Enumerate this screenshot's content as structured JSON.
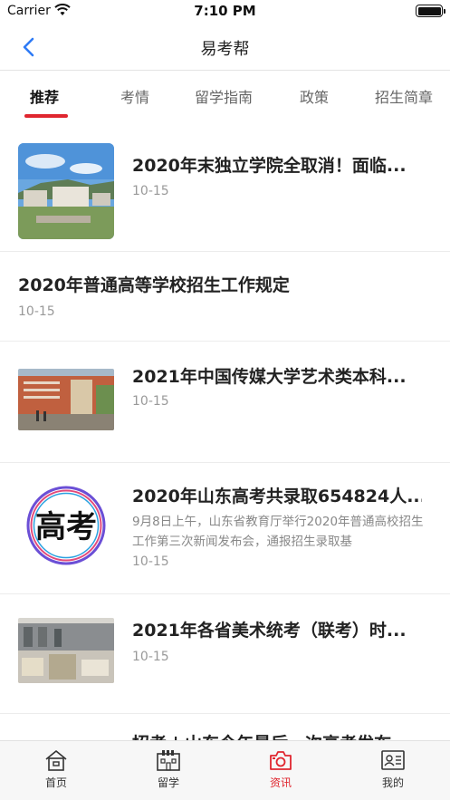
{
  "status_bar": {
    "carrier": "Carrier",
    "time": "7:10 PM"
  },
  "nav": {
    "title": "易考帮",
    "back_icon": "chevron-left-icon"
  },
  "tabs": [
    {
      "label": "推荐",
      "active": true
    },
    {
      "label": "考情",
      "active": false
    },
    {
      "label": "留学指南",
      "active": false
    },
    {
      "label": "政策",
      "active": false
    },
    {
      "label": "招生简章",
      "active": false
    }
  ],
  "articles": [
    {
      "title": "2020年末独立学院全取消！面临...",
      "date": "10-15"
    },
    {
      "title": "2020年普通高等学校招生工作规定",
      "date": "10-15"
    },
    {
      "title": "2021年中国传媒大学艺术类本科...",
      "date": "10-15"
    },
    {
      "title": "2020年山东高考共录取654824人...",
      "summary": "9月8日上午，山东省教育厅举行2020年普通高校招生工作第三次新闻发布会，通报招生录取基",
      "date": "10-15",
      "thumb_text": "高考"
    },
    {
      "title": "2021年各省美术统考（联考）时...",
      "date": "10-15"
    },
    {
      "title": "招考 | 山东今年最后一次高考发布...",
      "date": ""
    }
  ],
  "tab_bar": [
    {
      "label": "首页",
      "icon": "home-icon",
      "active": false
    },
    {
      "label": "留学",
      "icon": "building-icon",
      "active": false
    },
    {
      "label": "资讯",
      "icon": "camera-icon",
      "active": true
    },
    {
      "label": "我的",
      "icon": "profile-card-icon",
      "active": false
    }
  ],
  "colors": {
    "accent": "#e0262f",
    "back_arrow": "#2f7bf5",
    "date_text": "#999999"
  }
}
